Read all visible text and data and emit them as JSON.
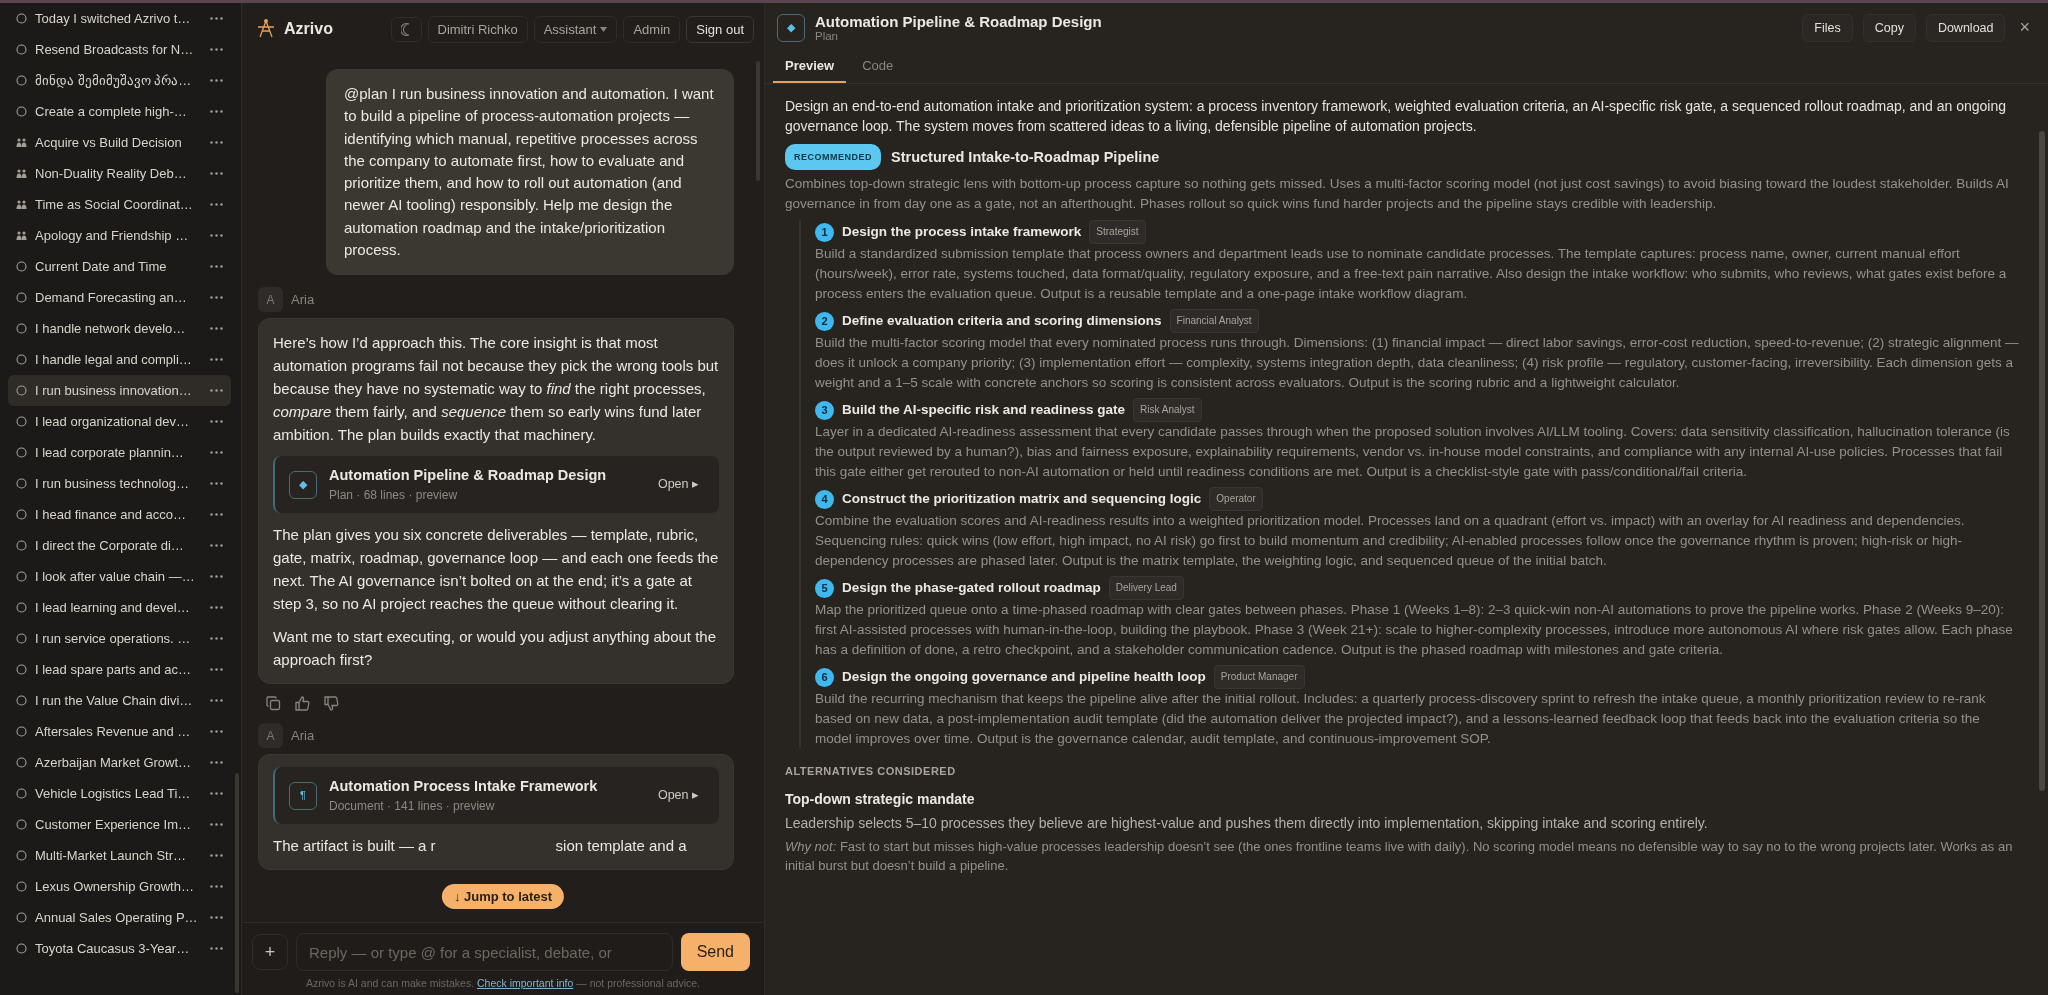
{
  "sidebar": {
    "items": [
      {
        "title": "Today I switched Azrivo t…",
        "kind": "chat",
        "selected": false
      },
      {
        "title": "Resend Broadcasts for N…",
        "kind": "chat",
        "selected": false
      },
      {
        "title": "მინდა შემიმუშავო პრა…",
        "kind": "chat",
        "selected": false
      },
      {
        "title": "Create a complete high-…",
        "kind": "chat",
        "selected": false
      },
      {
        "title": "Acquire vs Build Decision",
        "kind": "debate",
        "selected": false
      },
      {
        "title": "Non-Duality Reality Deb…",
        "kind": "debate",
        "selected": false
      },
      {
        "title": "Time as Social Coordinat…",
        "kind": "debate",
        "selected": false
      },
      {
        "title": "Apology and Friendship …",
        "kind": "debate",
        "selected": false
      },
      {
        "title": "Current Date and Time",
        "kind": "chat",
        "selected": false
      },
      {
        "title": "Demand Forecasting an…",
        "kind": "chat",
        "selected": false
      },
      {
        "title": "I handle network develo…",
        "kind": "chat",
        "selected": false
      },
      {
        "title": "I handle legal and compli…",
        "kind": "chat",
        "selected": false
      },
      {
        "title": "I run business innovation…",
        "kind": "chat",
        "selected": true
      },
      {
        "title": "I lead organizational dev…",
        "kind": "chat",
        "selected": false
      },
      {
        "title": "I lead corporate plannin…",
        "kind": "chat",
        "selected": false
      },
      {
        "title": "I run business technolog…",
        "kind": "chat",
        "selected": false
      },
      {
        "title": "I head finance and acco…",
        "kind": "chat",
        "selected": false
      },
      {
        "title": "I direct the Corporate di…",
        "kind": "chat",
        "selected": false
      },
      {
        "title": "I look after value chain —…",
        "kind": "chat",
        "selected": false
      },
      {
        "title": "I lead learning and devel…",
        "kind": "chat",
        "selected": false
      },
      {
        "title": "I run service operations. …",
        "kind": "chat",
        "selected": false
      },
      {
        "title": "I lead spare parts and ac…",
        "kind": "chat",
        "selected": false
      },
      {
        "title": "I run the Value Chain divi…",
        "kind": "chat",
        "selected": false
      },
      {
        "title": "Aftersales Revenue and …",
        "kind": "chat",
        "selected": false
      },
      {
        "title": "Azerbaijan Market Growt…",
        "kind": "chat",
        "selected": false
      },
      {
        "title": "Vehicle Logistics Lead Ti…",
        "kind": "chat",
        "selected": false
      },
      {
        "title": "Customer Experience Im…",
        "kind": "chat",
        "selected": false
      },
      {
        "title": "Multi-Market Launch Str…",
        "kind": "chat",
        "selected": false
      },
      {
        "title": "Lexus Ownership Growth…",
        "kind": "chat",
        "selected": false
      },
      {
        "title": "Annual Sales Operating P…",
        "kind": "chat",
        "selected": false
      },
      {
        "title": "Toyota Caucasus 3-Year…",
        "kind": "chat",
        "selected": false
      }
    ]
  },
  "header": {
    "brand": "Azrivo",
    "user": "Dimitri Richko",
    "mode": "Assistant",
    "admin": "Admin",
    "sign_out": "Sign out"
  },
  "messages": [
    {
      "kind": "user",
      "text": "@plan I run business innovation and automation. I want to build a pipeline of process-automation projects — identifying which manual, repetitive processes across the company to automate first, how to evaluate and prioritize them, and how to roll out automation (and newer AI tooling) responsibly. Help me design the automation roadmap and the intake/prioritization process."
    },
    {
      "kind": "assistant",
      "avatar": "A",
      "author": "Aria",
      "actions": true,
      "blocks": [
        {
          "kind": "paragraph",
          "text": "Here’s how I’d approach this. The core insight is that most automation programs fail not because they pick the wrong tools but because they have no systematic way to *find* the right processes, *compare* them fairly, and *sequence* them so early wins fund later ambition. The plan builds exactly that machinery."
        },
        {
          "kind": "artifact",
          "icon": "◆",
          "title": "Automation Pipeline & Roadmap Design",
          "meta": "Plan · 68 lines · preview",
          "open": "Open ▸"
        },
        {
          "kind": "paragraph",
          "text": "The plan gives you six concrete deliverables — template, rubric, gate, matrix, roadmap, governance loop — and each one feeds the next. The AI governance isn’t bolted on at the end; it’s a gate at step 3, so no AI project reaches the queue without clearing it."
        },
        {
          "kind": "paragraph",
          "text": "Want me to start executing, or would you adjust anything about the approach first?"
        }
      ]
    },
    {
      "kind": "assistant",
      "avatar": "A",
      "author": "Aria",
      "actions": false,
      "blocks": [
        {
          "kind": "artifact",
          "icon": "¶",
          "title": "Automation Process Intake Framework",
          "meta": "Document · 141 lines · preview",
          "open": "Open ▸"
        },
        {
          "kind": "partial",
          "fragments": [
            "The artifact is built — a r",
            "sion template and a"
          ]
        }
      ]
    }
  ],
  "jump_button": "↓ Jump to latest",
  "composer": {
    "add": "+",
    "placeholder": "Reply — or type @ for a specialist, debate, or",
    "send": "Send"
  },
  "disclaimer": {
    "before": "Azrivo is AI and can make mistakes.",
    "link": "Check important info",
    "after": "— not professional advice."
  },
  "panel": {
    "icon": "◆",
    "title": "Automation Pipeline & Roadmap Design",
    "subtitle": "Plan",
    "actions": [
      "Files",
      "Copy",
      "Download"
    ],
    "close": "×",
    "tabs": [
      {
        "label": "Preview",
        "selected": true
      },
      {
        "label": "Code",
        "selected": false
      }
    ],
    "intro": "Design an end-to-end automation intake and prioritization system: a process inventory framework, weighted evaluation criteria, an AI-specific risk gate, a sequenced rollout roadmap, and an ongoing governance loop. The system moves from scattered ideas to a living, defensible pipeline of automation projects.",
    "recommended": {
      "badge": "RECOMMENDED",
      "title": "Structured Intake-to-Roadmap Pipeline",
      "description": "Combines top-down strategic lens with bottom-up process capture so nothing gets missed. Uses a multi-factor scoring model (not just cost savings) to avoid biasing toward the loudest stakeholder. Builds AI governance in from day one as a gate, not an afterthought. Phases rollout so quick wins fund harder projects and the pipeline stays credible with leadership.",
      "steps": [
        {
          "number": "1",
          "title": "Design the process intake framework",
          "role": "Strategist",
          "description": "Build a standardized submission template that process owners and department leads use to nominate candidate processes. The template captures: process name, owner, current manual effort (hours/week), error rate, systems touched, data format/quality, regulatory exposure, and a free-text pain narrative. Also design the intake workflow: who submits, who reviews, what gates exist before a process enters the evaluation queue. Output is a reusable template and a one-page intake workflow diagram."
        },
        {
          "number": "2",
          "title": "Define evaluation criteria and scoring dimensions",
          "role": "Financial Analyst",
          "description": "Build the multi-factor scoring model that every nominated process runs through. Dimensions: (1) financial impact — direct labor savings, error-cost reduction, speed-to-revenue; (2) strategic alignment — does it unlock a company priority; (3) implementation effort — complexity, systems integration depth, data cleanliness; (4) risk profile — regulatory, customer-facing, irreversibility. Each dimension gets a weight and a 1–5 scale with concrete anchors so scoring is consistent across evaluators. Output is the scoring rubric and a lightweight calculator."
        },
        {
          "number": "3",
          "title": "Build the AI-specific risk and readiness gate",
          "role": "Risk Analyst",
          "description": "Layer in a dedicated AI-readiness assessment that every candidate passes through when the proposed solution involves AI/LLM tooling. Covers: data sensitivity classification, hallucination tolerance (is the output reviewed by a human?), bias and fairness exposure, explainability requirements, vendor vs. in-house model constraints, and compliance with any internal AI-use policies. Processes that fail this gate either get rerouted to non-AI automation or held until readiness conditions are met. Output is a checklist-style gate with pass/conditional/fail criteria."
        },
        {
          "number": "4",
          "title": "Construct the prioritization matrix and sequencing logic",
          "role": "Operator",
          "description": "Combine the evaluation scores and AI-readiness results into a weighted prioritization model. Processes land on a quadrant (effort vs. impact) with an overlay for AI readiness and dependencies. Sequencing rules: quick wins (low effort, high impact, no AI risk) go first to build momentum and credibility; AI-enabled processes follow once the governance rhythm is proven; high-risk or high-dependency processes are phased later. Output is the matrix template, the weighting logic, and sequenced queue of the initial batch."
        },
        {
          "number": "5",
          "title": "Design the phase-gated rollout roadmap",
          "role": "Delivery Lead",
          "description": "Map the prioritized queue onto a time-phased roadmap with clear gates between phases. Phase 1 (Weeks 1–8): 2–3 quick-win non-AI automations to prove the pipeline works. Phase 2 (Weeks 9–20): first AI-assisted processes with human-in-the-loop, building the playbook. Phase 3 (Week 21+): scale to higher-complexity processes, introduce more autonomous AI where risk gates allow. Each phase has a definition of done, a retro checkpoint, and a stakeholder communication cadence. Output is the phased roadmap with milestones and gate criteria."
        },
        {
          "number": "6",
          "title": "Design the ongoing governance and pipeline health loop",
          "role": "Product Manager",
          "description": "Build the recurring mechanism that keeps the pipeline alive after the initial rollout. Includes: a quarterly process-discovery sprint to refresh the intake queue, a monthly prioritization review to re-rank based on new data, a post-implementation audit template (did the automation deliver the projected impact?), and a lessons-learned feedback loop that feeds back into the evaluation criteria so the model improves over time. Output is the governance calendar, audit template, and continuous-improvement SOP."
        }
      ]
    },
    "alternatives": {
      "heading": "ALTERNATIVES CONSIDERED",
      "items": [
        {
          "title": "Top-down strategic mandate",
          "description": "Leadership selects 5–10 processes they believe are highest-value and pushes them directly into implementation, skipping intake and scoring entirely.",
          "why_not": "*Why not:* Fast to start but misses high-value processes leadership doesn’t see (the ones frontline teams live with daily). No scoring model means no defensible way to say no to the wrong projects later. Works as an initial burst but doesn’t build a pipeline."
        }
      ]
    }
  }
}
